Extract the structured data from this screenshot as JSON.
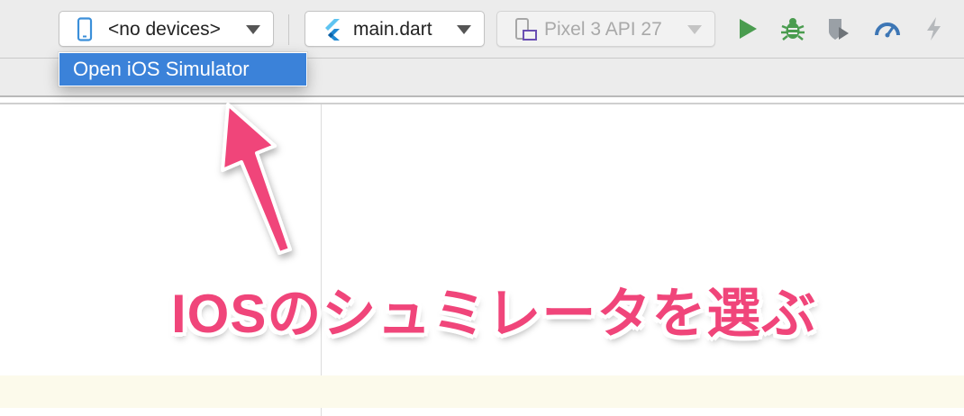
{
  "toolbar": {
    "device_selector": {
      "label": "<no devices>",
      "icon": "phone-icon"
    },
    "run_config": {
      "label": "main.dart",
      "icon": "flutter-icon"
    },
    "emulator_selector": {
      "label": "Pixel 3 API 27",
      "icon": "device-emulator-icon",
      "disabled": true
    },
    "actions": [
      {
        "name": "run",
        "icon": "play-icon",
        "color": "#4a9c4f"
      },
      {
        "name": "debug",
        "icon": "bug-icon",
        "color": "#4a9c4f"
      },
      {
        "name": "coverage",
        "icon": "shield-icon",
        "color": "#9aa0a6"
      },
      {
        "name": "profile",
        "icon": "gauge-icon",
        "color": "#3d76b5"
      },
      {
        "name": "hot-reload",
        "icon": "lightning-icon",
        "color": "#9aa0a6"
      }
    ]
  },
  "dropdown": {
    "items": [
      {
        "label": "Open iOS Simulator",
        "selected": true
      }
    ]
  },
  "annotation": {
    "text": "IOSのシュミレータを選ぶ",
    "color": "#f0457a"
  },
  "colors": {
    "selection": "#3b82d9",
    "toolbar_bg": "#ececec",
    "current_line": "#fcfaeb"
  }
}
